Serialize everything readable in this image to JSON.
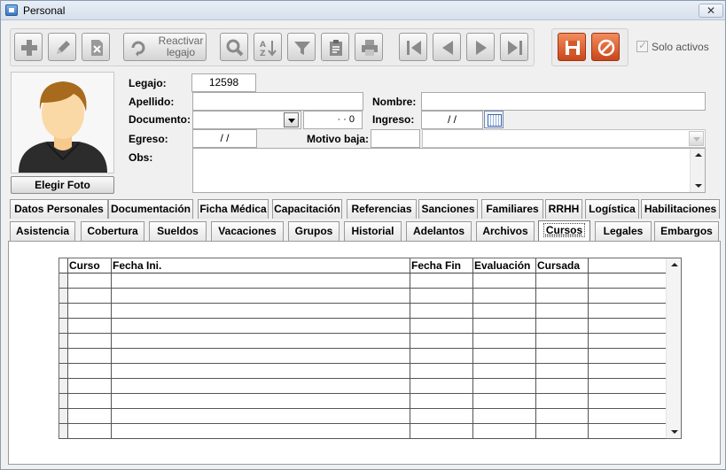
{
  "window": {
    "title": "Personal",
    "close": "✕"
  },
  "toolbar": {
    "reactivar_line1": "Reactivar",
    "reactivar_line2": "legajo",
    "solo_activos": "Solo activos"
  },
  "photo": {
    "button": "Elegir Foto"
  },
  "form": {
    "legajo_label": "Legajo:",
    "legajo_value": "12598",
    "apellido_label": "Apellido:",
    "apellido_value": "",
    "nombre_label": "Nombre:",
    "nombre_value": "",
    "documento_label": "Documento:",
    "documento_number": "  ·   ·  0",
    "ingreso_label": "Ingreso:",
    "ingreso_value": " / /",
    "egreso_label": "Egreso:",
    "egreso_value": " / /",
    "motivo_label": "Motivo baja:",
    "obs_label": "Obs:"
  },
  "tabs_row1": [
    "Datos Personales",
    "Documentación",
    "Ficha Médica",
    "Capacitación",
    "Referencias",
    "Sanciones",
    "Familiares",
    "RRHH",
    "Logística",
    "Habilitaciones"
  ],
  "tabs_row2": [
    "Asistencia",
    "Cobertura",
    "Sueldos",
    "Vacaciones",
    "Grupos",
    "Historial",
    "Adelantos",
    "Archivos",
    "Cursos",
    "Legales",
    "Embargos"
  ],
  "active_tab": "Cursos",
  "grid": {
    "columns": [
      "",
      "Curso",
      "Fecha Ini.",
      "Fecha Fin",
      "Evaluación",
      "Cursada"
    ],
    "row_count": 11
  }
}
